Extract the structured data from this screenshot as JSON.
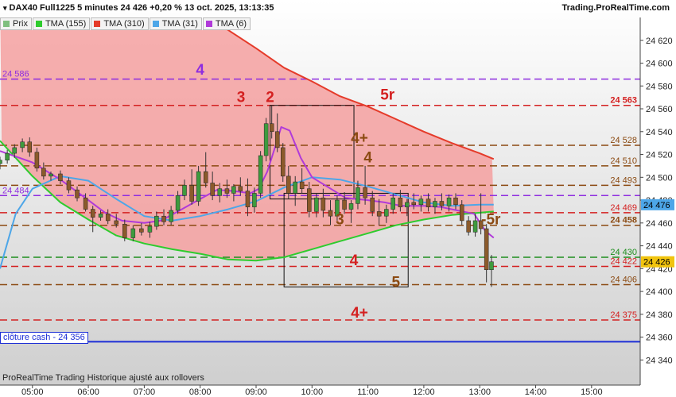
{
  "header": {
    "title": "DAX40 Full1225 5 minutes 24 426 +0,20 % 13 oct. 2025, 13:13:35",
    "site": "Trading.ProRealTime.com"
  },
  "legend": [
    {
      "label": "Prix",
      "color": "#7fbf7f"
    },
    {
      "label": "TMA (155)",
      "color": "#2ecc2e"
    },
    {
      "label": "TMA (310)",
      "color": "#e53b2a"
    },
    {
      "label": "TMA (31)",
      "color": "#4da6e8"
    },
    {
      "label": "TMA (6)",
      "color": "#b03ad9"
    }
  ],
  "footer": "ProRealTime Trading  Historique ajusté aux rollovers",
  "cash_close": {
    "label": "clôture cash -",
    "value": "24 356"
  },
  "chart_data": {
    "type": "line",
    "title": "DAX40 Full1225 5 minutes",
    "ylim": [
      24318,
      24640
    ],
    "y_ticks": [
      24340,
      24360,
      24380,
      24400,
      24420,
      24440,
      24460,
      24480,
      24500,
      24520,
      24540,
      24560,
      24580,
      24600,
      24620
    ],
    "y_tick_labels": [
      "24 340",
      "24 360",
      "24 380",
      "24 400",
      "24 420",
      "24 440",
      "24 460",
      "24 480",
      "24 500",
      "24 520",
      "24 540",
      "24 560",
      "24 580",
      "24 600",
      "24 620"
    ],
    "x_tick_labels": [
      "05:00",
      "06:00",
      "07:00",
      "08:00",
      "09:00",
      "10:00",
      "11:00",
      "12:00",
      "13:00",
      "14:00",
      "15:00"
    ],
    "x_tick_hours": [
      5,
      6,
      7,
      8,
      9,
      10,
      11,
      12,
      13,
      14,
      15
    ],
    "x_range_hours": [
      4.42,
      15.87
    ],
    "last_price": {
      "value": 24426,
      "label": "24 426",
      "color": "#f1c40f"
    },
    "tma31_last": {
      "value": 24476,
      "label": "24 476",
      "color": "#4da6e8"
    },
    "levels": [
      {
        "value": 24586,
        "color": "#8e2de0",
        "style": "dashed",
        "left_label": "24 586"
      },
      {
        "value": 24563,
        "color": "#d42020",
        "style": "dashed",
        "right_label": "24 563",
        "right_bold": true
      },
      {
        "value": 24528,
        "color": "#8b4a12",
        "style": "dashed",
        "right_label": "24 528"
      },
      {
        "value": 24510,
        "color": "#8b4a12",
        "style": "dashed",
        "right_label": "24 510"
      },
      {
        "value": 24493,
        "color": "#8b4a12",
        "style": "dashed",
        "right_label": "24 493"
      },
      {
        "value": 24484,
        "color": "#8e2de0",
        "style": "dashed",
        "left_label": "24 484"
      },
      {
        "value": 24469,
        "color": "#d42020",
        "style": "dashed",
        "right_label": "24 469"
      },
      {
        "value": 24458,
        "color": "#8b4a12",
        "style": "dashed",
        "right_label": "24 458",
        "right_bold": true
      },
      {
        "value": 24430,
        "color": "#1f8f1f",
        "style": "dashed",
        "right_label": "24 430"
      },
      {
        "value": 24422,
        "color": "#d42020",
        "style": "dashed",
        "right_label": "24 422"
      },
      {
        "value": 24406,
        "color": "#8b4a12",
        "style": "dashed",
        "right_label": "24 406"
      },
      {
        "value": 24375,
        "color": "#d42020",
        "style": "dashed",
        "right_label": "24 375"
      },
      {
        "value": 24356,
        "color": "#1d2fd6",
        "style": "solid"
      }
    ],
    "annotations": [
      {
        "text": "4",
        "x": 8.0,
        "y": 24590,
        "color": "#8e2de0"
      },
      {
        "text": "3",
        "x": 8.73,
        "y": 24566,
        "color": "#d42020"
      },
      {
        "text": "2",
        "x": 9.25,
        "y": 24566,
        "color": "#d42020"
      },
      {
        "text": "5r",
        "x": 11.35,
        "y": 24568,
        "color": "#d42020"
      },
      {
        "text": "4+",
        "x": 10.85,
        "y": 24530,
        "color": "#8b4a12"
      },
      {
        "text": "4",
        "x": 11.0,
        "y": 24513,
        "color": "#8b4a12"
      },
      {
        "text": "3",
        "x": 10.5,
        "y": 24459,
        "color": "#8b4a12"
      },
      {
        "text": "-5r",
        "x": 13.2,
        "y": 24459,
        "color": "#8b4a12"
      },
      {
        "text": "4",
        "x": 10.75,
        "y": 24423,
        "color": "#d42020"
      },
      {
        "text": "5",
        "x": 11.5,
        "y": 24404,
        "color": "#8b4a12"
      },
      {
        "text": "4+",
        "x": 10.85,
        "y": 24377,
        "color": "#d42020"
      }
    ],
    "boxes": [
      {
        "x1": 9.25,
        "x2": 10.75,
        "y1": 24481,
        "y2": 24563
      },
      {
        "x1": 9.5,
        "x2": 11.72,
        "y1": 24404,
        "y2": 24486
      }
    ],
    "series": [
      {
        "name": "TMA (155)",
        "color": "#2ecc2e",
        "x": [
          4.42,
          5.0,
          5.5,
          6.0,
          6.5,
          7.0,
          7.5,
          8.0,
          8.5,
          9.0,
          9.5,
          10.0,
          10.5,
          11.0,
          11.5,
          12.0,
          12.5,
          13.0,
          13.25
        ],
        "y": [
          24532,
          24501,
          24478,
          24463,
          24449,
          24442,
          24437,
          24433,
          24428,
          24427,
          24430,
          24437,
          24444,
          24451,
          24458,
          24463,
          24467,
          24469,
          24470
        ]
      },
      {
        "name": "TMA (310)",
        "color": "#e53b2a",
        "x": [
          4.42,
          5.0,
          6.0,
          7.0,
          7.5,
          8.0,
          8.5,
          9.0,
          9.5,
          10.0,
          10.5,
          11.0,
          11.5,
          12.0,
          12.5,
          13.0,
          13.25
        ],
        "y": [
          24660,
          24665,
          24664,
          24659,
          24654,
          24644,
          24629,
          24613,
          24596,
          24584,
          24571,
          24562,
          24551,
          24540,
          24530,
          24521,
          24516
        ]
      },
      {
        "name": "TMA (31)",
        "color": "#4da6e8",
        "x": [
          4.42,
          4.7,
          5.0,
          5.5,
          6.0,
          6.5,
          7.0,
          7.5,
          8.0,
          8.5,
          9.0,
          9.5,
          10.0,
          10.5,
          11.0,
          11.5,
          12.0,
          12.5,
          13.0,
          13.25
        ],
        "y": [
          24420,
          24468,
          24490,
          24501,
          24497,
          24481,
          24466,
          24462,
          24466,
          24472,
          24479,
          24491,
          24500,
          24498,
          24492,
          24485,
          24478,
          24475,
          24476,
          24476
        ]
      },
      {
        "name": "TMA (6)",
        "color": "#b03ad9",
        "x": [
          4.42,
          5.0,
          5.5,
          6.0,
          6.3,
          6.6,
          7.0,
          7.3,
          7.6,
          8.0,
          8.3,
          8.6,
          8.9,
          9.05,
          9.2,
          9.35,
          9.45,
          9.6,
          9.8,
          10.0,
          10.3,
          10.6,
          11.0,
          11.3,
          11.6,
          12.0,
          12.3,
          12.6,
          12.9,
          13.1,
          13.25
        ],
        "y": [
          24523,
          24513,
          24498,
          24480,
          24469,
          24462,
          24460,
          24462,
          24470,
          24481,
          24489,
          24488,
          24486,
          24490,
          24505,
          24528,
          24544,
          24541,
          24517,
          24500,
          24491,
          24482,
          24480,
          24478,
          24475,
          24475,
          24474,
          24471,
          24468,
          24453,
          24447
        ]
      }
    ],
    "candles": [
      {
        "x": 4.42,
        "o": 24512,
        "h": 24518,
        "l": 24507,
        "c": 24515
      },
      {
        "x": 4.55,
        "o": 24515,
        "h": 24524,
        "l": 24512,
        "c": 24521
      },
      {
        "x": 4.68,
        "o": 24521,
        "h": 24529,
        "l": 24517,
        "c": 24526
      },
      {
        "x": 4.82,
        "o": 24526,
        "h": 24534,
        "l": 24522,
        "c": 24531
      },
      {
        "x": 4.95,
        "o": 24531,
        "h": 24535,
        "l": 24518,
        "c": 24522
      },
      {
        "x": 5.08,
        "o": 24522,
        "h": 24526,
        "l": 24505,
        "c": 24508
      },
      {
        "x": 5.2,
        "o": 24508,
        "h": 24513,
        "l": 24498,
        "c": 24501
      },
      {
        "x": 5.33,
        "o": 24501,
        "h": 24505,
        "l": 24497,
        "c": 24503
      },
      {
        "x": 5.5,
        "o": 24503,
        "h": 24506,
        "l": 24494,
        "c": 24497
      },
      {
        "x": 5.65,
        "o": 24497,
        "h": 24500,
        "l": 24486,
        "c": 24489
      },
      {
        "x": 5.8,
        "o": 24489,
        "h": 24492,
        "l": 24479,
        "c": 24482
      },
      {
        "x": 5.95,
        "o": 24482,
        "h": 24486,
        "l": 24470,
        "c": 24472
      },
      {
        "x": 6.08,
        "o": 24472,
        "h": 24475,
        "l": 24452,
        "c": 24465
      },
      {
        "x": 6.22,
        "o": 24465,
        "h": 24471,
        "l": 24462,
        "c": 24468
      },
      {
        "x": 6.35,
        "o": 24468,
        "h": 24472,
        "l": 24459,
        "c": 24462
      },
      {
        "x": 6.5,
        "o": 24462,
        "h": 24468,
        "l": 24456,
        "c": 24459
      },
      {
        "x": 6.65,
        "o": 24459,
        "h": 24463,
        "l": 24444,
        "c": 24447
      },
      {
        "x": 6.8,
        "o": 24447,
        "h": 24458,
        "l": 24444,
        "c": 24455
      },
      {
        "x": 6.95,
        "o": 24455,
        "h": 24460,
        "l": 24449,
        "c": 24452
      },
      {
        "x": 7.1,
        "o": 24452,
        "h": 24461,
        "l": 24447,
        "c": 24457
      },
      {
        "x": 7.22,
        "o": 24457,
        "h": 24470,
        "l": 24454,
        "c": 24466
      },
      {
        "x": 7.35,
        "o": 24466,
        "h": 24472,
        "l": 24458,
        "c": 24461
      },
      {
        "x": 7.48,
        "o": 24461,
        "h": 24475,
        "l": 24458,
        "c": 24471
      },
      {
        "x": 7.6,
        "o": 24471,
        "h": 24488,
        "l": 24468,
        "c": 24484
      },
      {
        "x": 7.72,
        "o": 24484,
        "h": 24498,
        "l": 24480,
        "c": 24493
      },
      {
        "x": 7.85,
        "o": 24493,
        "h": 24507,
        "l": 24476,
        "c": 24479
      },
      {
        "x": 7.97,
        "o": 24479,
        "h": 24510,
        "l": 24475,
        "c": 24505
      },
      {
        "x": 8.1,
        "o": 24505,
        "h": 24522,
        "l": 24491,
        "c": 24495
      },
      {
        "x": 8.22,
        "o": 24495,
        "h": 24505,
        "l": 24480,
        "c": 24484
      },
      {
        "x": 8.35,
        "o": 24484,
        "h": 24495,
        "l": 24478,
        "c": 24490
      },
      {
        "x": 8.48,
        "o": 24490,
        "h": 24498,
        "l": 24482,
        "c": 24486
      },
      {
        "x": 8.6,
        "o": 24486,
        "h": 24494,
        "l": 24479,
        "c": 24492
      },
      {
        "x": 8.72,
        "o": 24492,
        "h": 24500,
        "l": 24484,
        "c": 24488
      },
      {
        "x": 8.85,
        "o": 24488,
        "h": 24499,
        "l": 24466,
        "c": 24474
      },
      {
        "x": 8.97,
        "o": 24474,
        "h": 24491,
        "l": 24469,
        "c": 24486
      },
      {
        "x": 9.08,
        "o": 24486,
        "h": 24523,
        "l": 24482,
        "c": 24519
      },
      {
        "x": 9.18,
        "o": 24519,
        "h": 24552,
        "l": 24514,
        "c": 24547
      },
      {
        "x": 9.28,
        "o": 24547,
        "h": 24563,
        "l": 24534,
        "c": 24540
      },
      {
        "x": 9.38,
        "o": 24540,
        "h": 24556,
        "l": 24522,
        "c": 24526
      },
      {
        "x": 9.48,
        "o": 24526,
        "h": 24530,
        "l": 24496,
        "c": 24501
      },
      {
        "x": 9.58,
        "o": 24501,
        "h": 24510,
        "l": 24481,
        "c": 24486
      },
      {
        "x": 9.7,
        "o": 24486,
        "h": 24501,
        "l": 24475,
        "c": 24496
      },
      {
        "x": 9.82,
        "o": 24496,
        "h": 24508,
        "l": 24486,
        "c": 24490
      },
      {
        "x": 9.95,
        "o": 24490,
        "h": 24496,
        "l": 24465,
        "c": 24470
      },
      {
        "x": 10.08,
        "o": 24470,
        "h": 24486,
        "l": 24465,
        "c": 24482
      },
      {
        "x": 10.2,
        "o": 24482,
        "h": 24490,
        "l": 24465,
        "c": 24471
      },
      {
        "x": 10.33,
        "o": 24471,
        "h": 24480,
        "l": 24458,
        "c": 24466
      },
      {
        "x": 10.45,
        "o": 24466,
        "h": 24484,
        "l": 24462,
        "c": 24480
      },
      {
        "x": 10.58,
        "o": 24480,
        "h": 24487,
        "l": 24468,
        "c": 24472
      },
      {
        "x": 10.7,
        "o": 24472,
        "h": 24480,
        "l": 24460,
        "c": 24477
      },
      {
        "x": 10.82,
        "o": 24477,
        "h": 24497,
        "l": 24472,
        "c": 24491
      },
      {
        "x": 10.95,
        "o": 24491,
        "h": 24510,
        "l": 24476,
        "c": 24482
      },
      {
        "x": 11.08,
        "o": 24482,
        "h": 24488,
        "l": 24466,
        "c": 24470
      },
      {
        "x": 11.2,
        "o": 24470,
        "h": 24481,
        "l": 24458,
        "c": 24466
      },
      {
        "x": 11.33,
        "o": 24466,
        "h": 24476,
        "l": 24460,
        "c": 24472
      },
      {
        "x": 11.45,
        "o": 24472,
        "h": 24486,
        "l": 24468,
        "c": 24482
      },
      {
        "x": 11.58,
        "o": 24482,
        "h": 24489,
        "l": 24470,
        "c": 24474
      },
      {
        "x": 11.7,
        "o": 24474,
        "h": 24481,
        "l": 24466,
        "c": 24478
      },
      {
        "x": 11.82,
        "o": 24478,
        "h": 24486,
        "l": 24472,
        "c": 24476
      },
      {
        "x": 11.95,
        "o": 24476,
        "h": 24484,
        "l": 24470,
        "c": 24481
      },
      {
        "x": 12.08,
        "o": 24481,
        "h": 24486,
        "l": 24470,
        "c": 24474
      },
      {
        "x": 12.2,
        "o": 24474,
        "h": 24482,
        "l": 24468,
        "c": 24479
      },
      {
        "x": 12.32,
        "o": 24479,
        "h": 24486,
        "l": 24471,
        "c": 24475
      },
      {
        "x": 12.45,
        "o": 24475,
        "h": 24485,
        "l": 24470,
        "c": 24482
      },
      {
        "x": 12.57,
        "o": 24482,
        "h": 24486,
        "l": 24472,
        "c": 24476
      },
      {
        "x": 12.68,
        "o": 24476,
        "h": 24480,
        "l": 24458,
        "c": 24462
      },
      {
        "x": 12.8,
        "o": 24462,
        "h": 24466,
        "l": 24449,
        "c": 24452
      },
      {
        "x": 12.92,
        "o": 24452,
        "h": 24468,
        "l": 24448,
        "c": 24462
      },
      {
        "x": 13.02,
        "o": 24462,
        "h": 24486,
        "l": 24450,
        "c": 24455
      },
      {
        "x": 13.12,
        "o": 24455,
        "h": 24459,
        "l": 24408,
        "c": 24419
      },
      {
        "x": 13.21,
        "o": 24419,
        "h": 24432,
        "l": 24404,
        "c": 24426
      }
    ]
  }
}
